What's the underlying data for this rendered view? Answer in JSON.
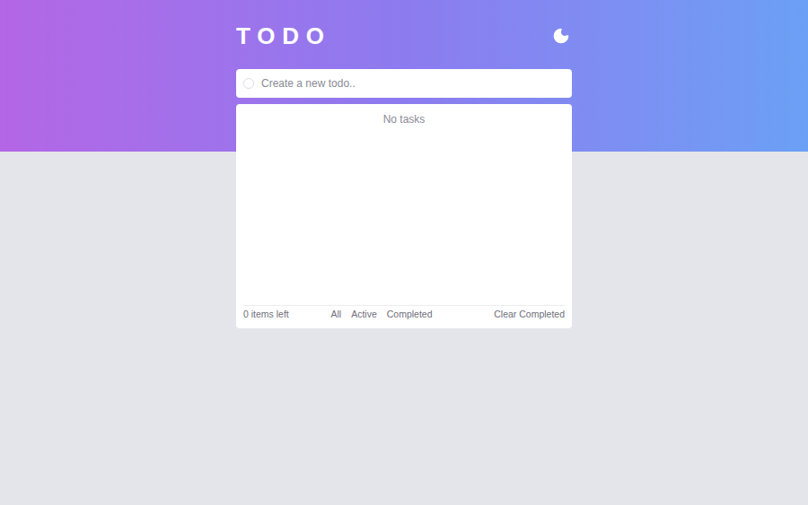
{
  "header": {
    "title": "TODO"
  },
  "new_todo": {
    "placeholder": "Create a new todo..",
    "value": ""
  },
  "list": {
    "empty_message": "No tasks",
    "items": []
  },
  "footer": {
    "items_left": "0 items left",
    "filters": [
      {
        "label": "All",
        "selected": false
      },
      {
        "label": "Active",
        "selected": false
      },
      {
        "label": "Completed",
        "selected": false
      }
    ],
    "clear": "Clear Completed"
  }
}
